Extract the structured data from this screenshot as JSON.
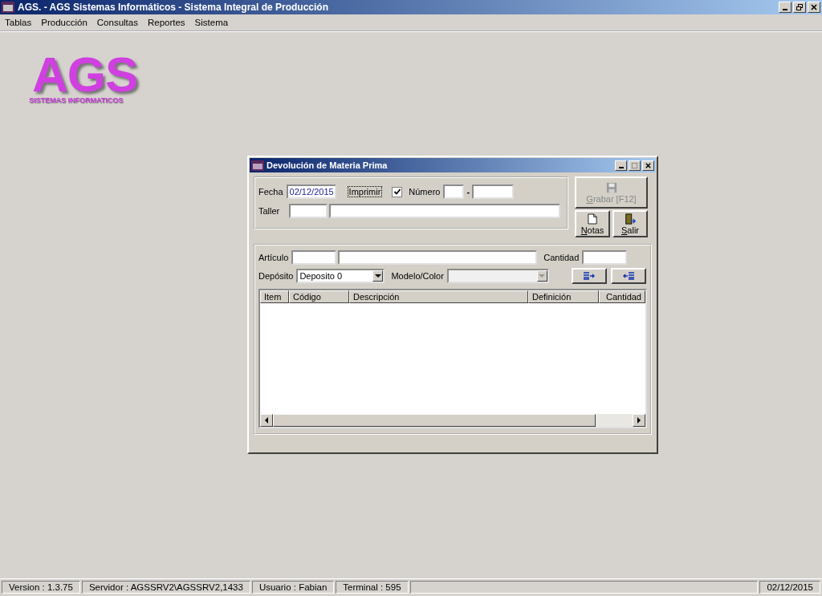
{
  "window": {
    "title": "AGS. - AGS Sistemas Informáticos - Sistema Integral de Producción"
  },
  "menu": [
    "Tablas",
    "Producción",
    "Consultas",
    "Reportes",
    "Sistema"
  ],
  "logo": {
    "main": "AGS",
    "sub": "SISTEMAS INFORMATICOS"
  },
  "dialog": {
    "title": "Devolución de Materia Prima",
    "fecha": {
      "label": "Fecha",
      "value": "02/12/2015"
    },
    "imprimir": {
      "label": "Imprimir",
      "checked": true
    },
    "numero": {
      "label": "Número",
      "separator": "-"
    },
    "taller": {
      "label": "Taller"
    },
    "buttons": [
      {
        "kind": "save",
        "label": "Grabar [F12]",
        "disabled": true
      },
      {
        "kind": "notes",
        "label": "Notas",
        "disabled": false
      },
      {
        "kind": "exit",
        "label": "Salir",
        "disabled": false
      }
    ],
    "articulo": {
      "label": "Artículo"
    },
    "cantidad": {
      "label": "Cantidad"
    },
    "deposito": {
      "label": "Depósito",
      "value": "Deposito 0",
      "disabled": false
    },
    "modelo": {
      "label": "Modelo/Color",
      "disabled": true
    },
    "columns": [
      "Item",
      "Código",
      "Descripción",
      "Definición",
      "Cantidad"
    ]
  },
  "status_bar": [
    "Version : 1.3.75",
    "Servidor : AGSSRV2\\AGSSRV2,1433",
    "Usuario : Fabian",
    "Terminal : 595",
    "02/12/2015"
  ]
}
